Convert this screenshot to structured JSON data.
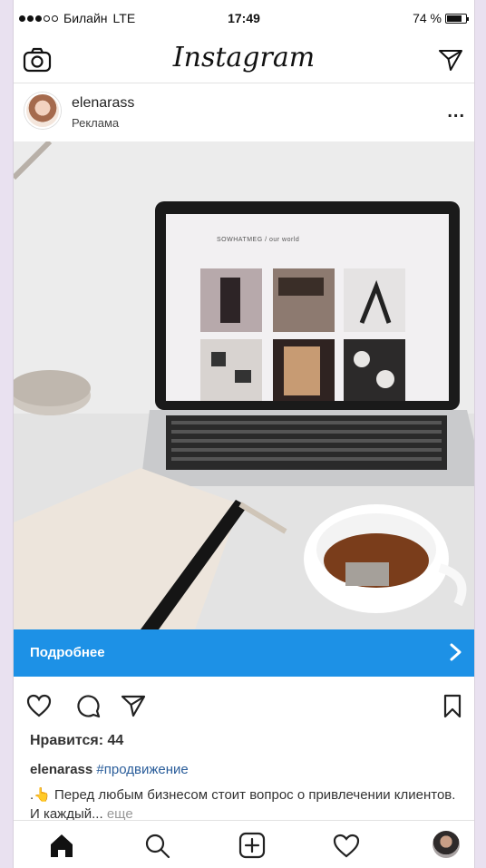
{
  "status_bar": {
    "carrier": "Билайн",
    "network": "LTE",
    "time": "17:49",
    "battery_text": "74 %",
    "battery_level": 0.74,
    "signal_dots_filled": 3,
    "signal_dots_total": 5
  },
  "header": {
    "app_title": "Instagram",
    "left_icon": "camera-icon",
    "right_icon": "direct-message-icon"
  },
  "post": {
    "username": "elenarass",
    "sponsored_label": "Реклама",
    "more_icon": "more-options-icon",
    "more_text": "...",
    "image_screen_text": "SOWHATMEG / our world",
    "cta_label": "Подробнее",
    "cta_icon": "chevron-right-icon",
    "likes_text": "Нравится: 44",
    "caption_username": "elenarass",
    "caption_hashtag": "#продвижение",
    "caption_text": "Перед любым бизнесом стоит вопрос о привлечении клиентов. И каждый...",
    "caption_more": "еще",
    "caption_emoji": ".👆"
  },
  "actions": [
    "like-icon",
    "comment-icon",
    "share-icon",
    "save-icon"
  ],
  "tabbar": [
    "home-icon",
    "search-icon",
    "new-post-icon",
    "activity-icon",
    "profile-avatar"
  ],
  "colors": {
    "cta_blue": "#1d91e6",
    "hashtag_blue": "#2a5d9a",
    "text_dark": "#222222",
    "background": "#e9e1f0"
  }
}
